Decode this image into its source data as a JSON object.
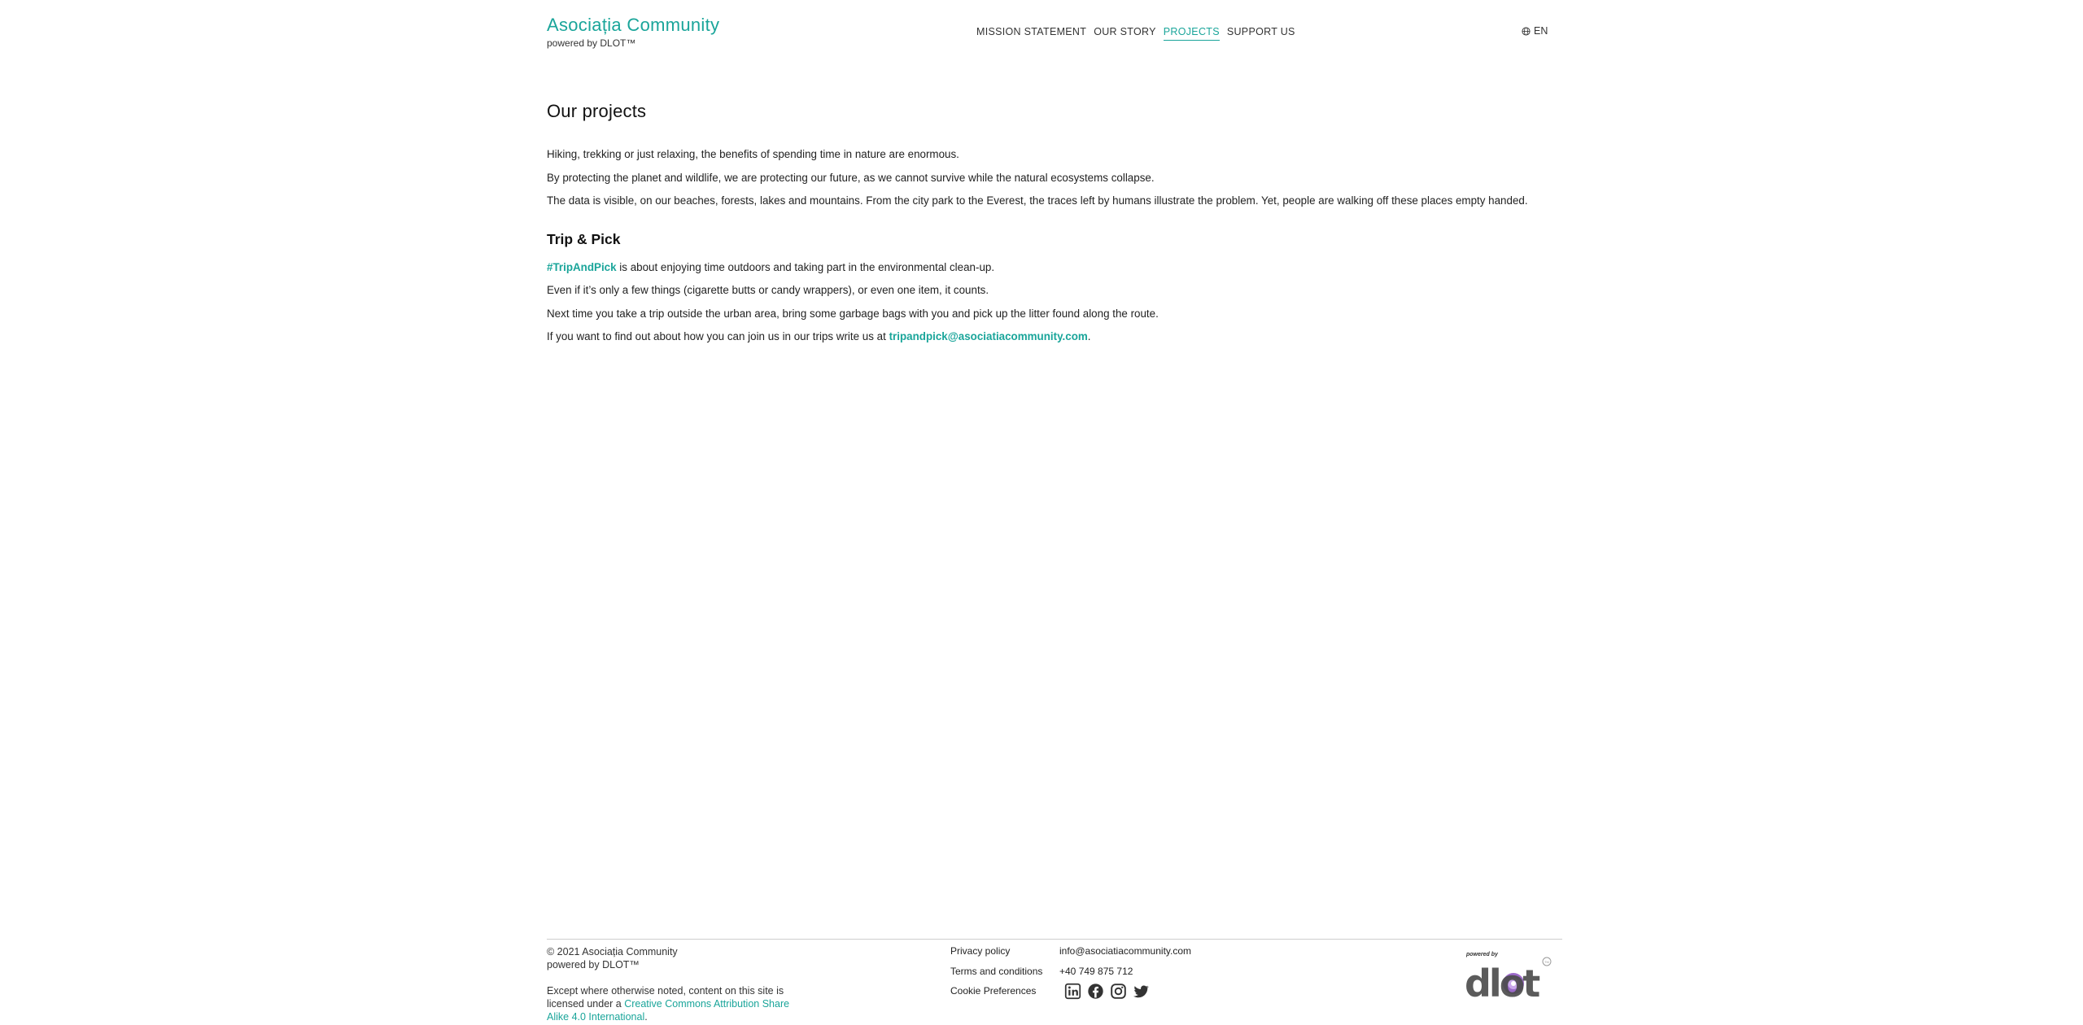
{
  "header": {
    "brand_name": "Asociația Community",
    "brand_sub": "powered by DLOT™",
    "nav": [
      "MISSION STATEMENT",
      "OUR STORY",
      "PROJECTS",
      "SUPPORT US"
    ],
    "active_nav": "PROJECTS",
    "language": "EN"
  },
  "main": {
    "title": "Our projects",
    "intro": [
      "Hiking, trekking or just relaxing, the benefits of spending time in nature are enormous.",
      "By protecting the planet and wildlife, we are protecting our future, as we cannot survive while the natural ecosystems collapse.",
      "The data is visible, on our beaches, forests, lakes and mountains. From the city park to the Everest, the traces left by humans illustrate the problem. Yet, people are walking off these places empty handed."
    ],
    "section_title": "Trip & Pick",
    "hashtag": "#TripAndPick",
    "line1_rest": " is about enjoying time outdoors and taking part in the environmental clean-up.",
    "line2": "Even if it’s only a few things (cigarette butts or candy wrappers), or even one item, it counts.",
    "line3": "Next time you take a trip outside the urban area, bring some garbage bags with you and pick up the litter found along the route.",
    "line4_prefix": "If you want to find out about how you can join us in our trips write us at ",
    "email": "tripandpick@asociatiacommunity.com",
    "line4_suffix": "."
  },
  "footer": {
    "copyright": "© 2021 Asociația Community",
    "powered": "powered by DLOT™",
    "license_prefix": "Except where otherwise noted, content on this site is licensed under a ",
    "license_link": "Creative Commons Attribution Share Alike 4.0 International",
    "license_suffix": ".",
    "links": [
      "Privacy policy",
      "Terms and conditions",
      "Cookie Preferences"
    ],
    "contact_email": "info@asociatiacommunity.com",
    "contact_phone": "+40 749 875 712",
    "social_icons": [
      "linkedin-icon",
      "facebook-icon",
      "instagram-icon",
      "twitter-icon"
    ],
    "logo_small_text": "powered by",
    "logo_text": "dlot",
    "logo_mark": "TM"
  },
  "colors": {
    "accent": "#1aa59a",
    "dlot_purple": "#8a4fbf",
    "dark": "#333333"
  }
}
